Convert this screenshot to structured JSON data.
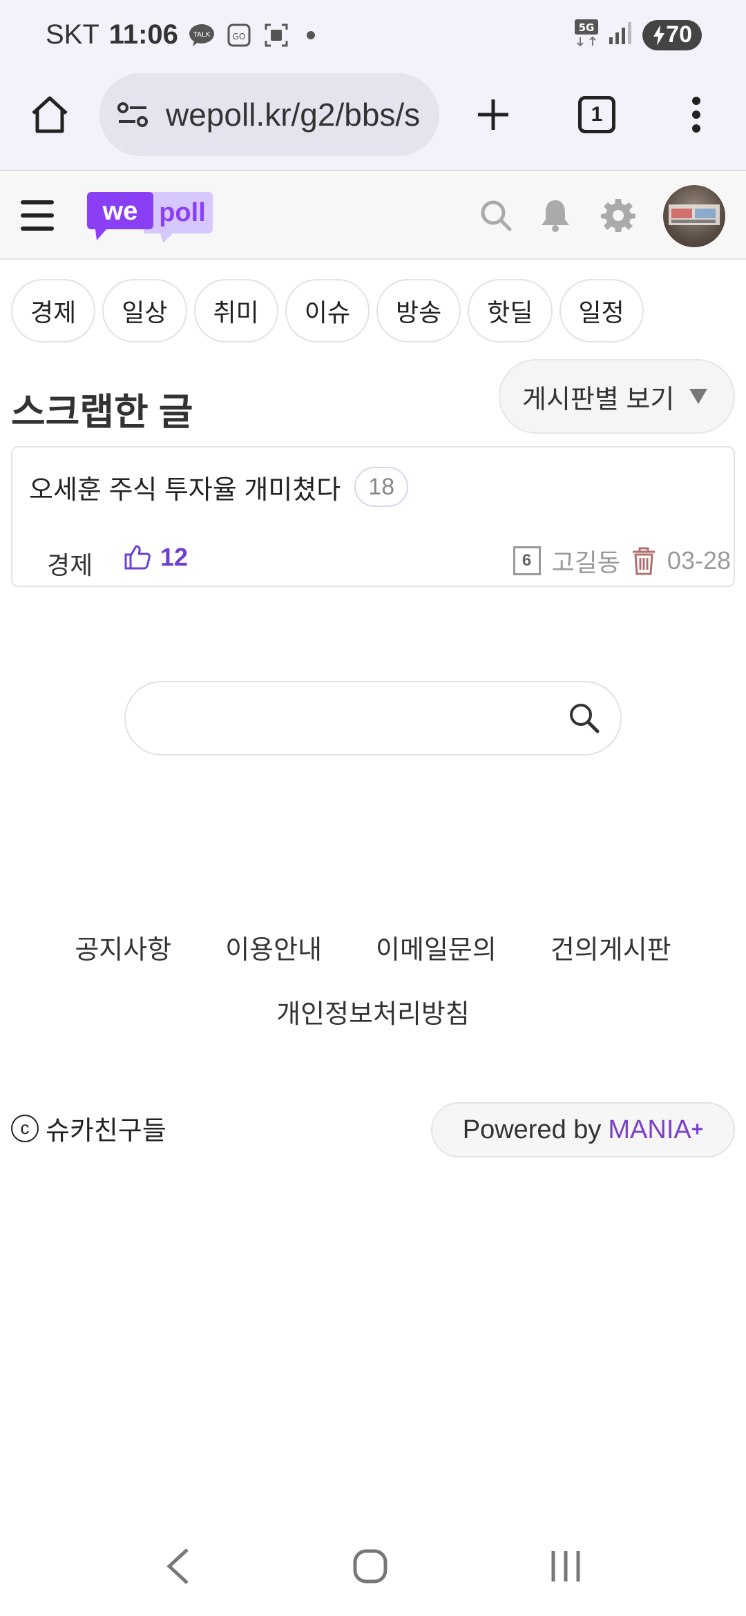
{
  "status_bar": {
    "carrier": "SKT",
    "time": "11:06",
    "network": "5G",
    "battery": "70"
  },
  "browser": {
    "url": "wepoll.kr/g2/bbs/s",
    "tab_count": "1"
  },
  "site": {
    "logo_we": "we",
    "logo_poll": "poll"
  },
  "categories": [
    "경제",
    "일상",
    "취미",
    "이슈",
    "방송",
    "핫딜",
    "일정"
  ],
  "section": {
    "title": "스크랩한 글",
    "board_view_label": "게시판별 보기"
  },
  "post": {
    "title": "오세훈 주식 투자율 개미쳤다",
    "comment_count": "18",
    "category": "경제",
    "likes": "12",
    "calendar_day": "6",
    "author": "고길동",
    "date": "03-28"
  },
  "search": {
    "value": ""
  },
  "footer": {
    "links_row1": [
      "공지사항",
      "이용안내",
      "이메일문의",
      "건의게시판"
    ],
    "links_row2": [
      "개인정보처리방침"
    ],
    "copyright_symbol": "c",
    "copyright_name": "슈카친구들",
    "powered_prefix": "Powered by",
    "powered_brand": "MANIA",
    "powered_plus": "+"
  },
  "colors": {
    "accent": "#7c3fc8",
    "logo_dark": "#8b3ff5",
    "logo_light": "#d6c8ff"
  }
}
